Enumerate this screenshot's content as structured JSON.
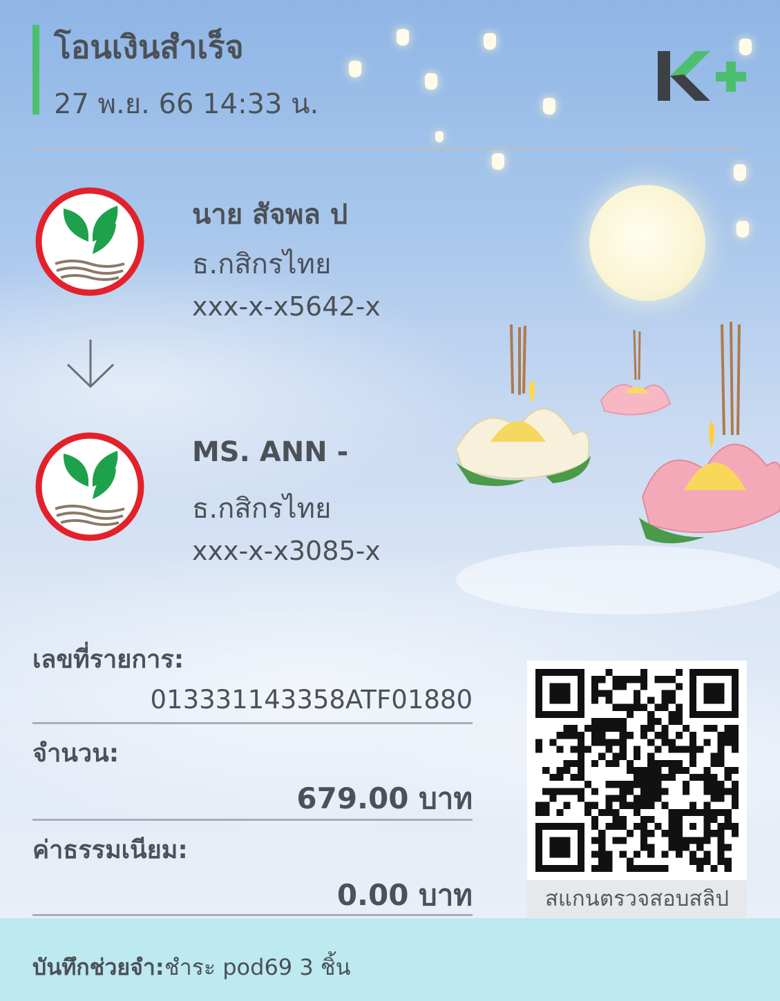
{
  "header": {
    "title": "โอนเงินสำเร็จ",
    "datetime": "27 พ.ย. 66  14:33 น.",
    "brand_logo": "K+"
  },
  "sender": {
    "name": "นาย สัจพล ป",
    "bank": "ธ.กสิกรไทย",
    "account": "xxx-x-x5642-x",
    "bank_icon": "kasikorn-bank-icon"
  },
  "receiver": {
    "name": "MS. ANN -",
    "bank": "ธ.กสิกรไทย",
    "account": "xxx-x-x3085-x",
    "bank_icon": "kasikorn-bank-icon"
  },
  "transaction": {
    "ref_label": "เลขที่รายการ:",
    "ref_value": "013331143358ATF01880",
    "amount_label": "จำนวน:",
    "amount_value": "679.00 บาท",
    "fee_label": "ค่าธรรมเนียม:",
    "fee_value": "0.00 บาท"
  },
  "qr": {
    "caption": "สแกนตรวจสอบสลิป"
  },
  "memo": {
    "label": "บันทึกช่วยจำ:",
    "value": "ชำระ pod69 3 ชิ้น"
  },
  "colors": {
    "accent_green": "#4cbf6e",
    "kbank_red": "#e3212b",
    "kbank_green": "#1ea14b",
    "memo_bar": "#bde9f1"
  }
}
